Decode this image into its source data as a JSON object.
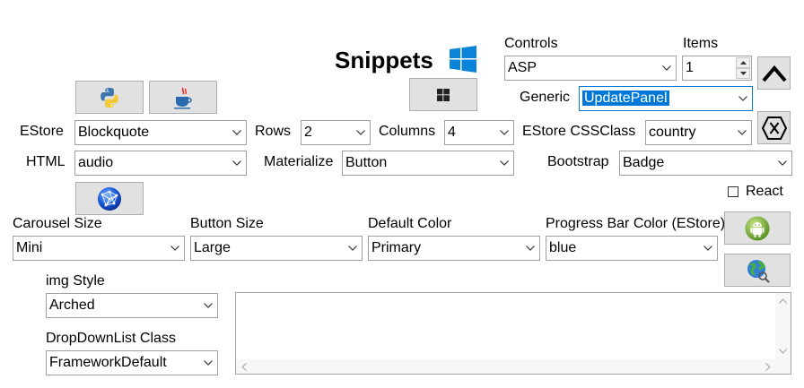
{
  "title": "Snippets",
  "controls": {
    "label": "Controls",
    "value": "ASP",
    "items_label": "Items",
    "items_value": "1",
    "generic_label": "Generic",
    "generic_value": "UpdatePanel"
  },
  "estore": {
    "label": "EStore",
    "value": "Blockquote",
    "rows_label": "Rows",
    "rows_value": "2",
    "columns_label": "Columns",
    "columns_value": "4",
    "cssclass_label": "EStore CSSClass",
    "cssclass_value": "country"
  },
  "html": {
    "label": "HTML",
    "value": "audio",
    "materialize_label": "Materialize",
    "materialize_value": "Button",
    "bootstrap_label": "Bootstrap",
    "bootstrap_value": "Badge"
  },
  "react": {
    "label": "React",
    "checked": false
  },
  "carousel": {
    "label": "Carousel Size",
    "value": "Mini"
  },
  "button_size": {
    "label": "Button Size",
    "value": "Large"
  },
  "default_color": {
    "label": "Default Color",
    "value": "Primary"
  },
  "progress": {
    "label": "Progress Bar Color (EStore)",
    "value": "blue"
  },
  "img_style": {
    "label": "img Style",
    "value": "Arched"
  },
  "dropdownlist": {
    "label": "DropDownList Class",
    "value": "FrameworkDefault"
  },
  "colors": {
    "selection": "#0078d7",
    "windows_blue": "#0a84d8",
    "android_green": "#7cb32a"
  }
}
